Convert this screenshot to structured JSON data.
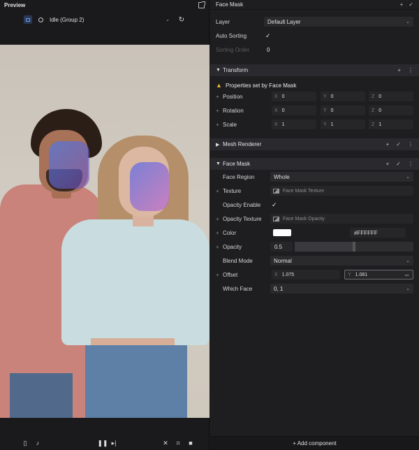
{
  "preview": {
    "title": "Preview",
    "state_select": "Idle (Group 2)"
  },
  "inspector": {
    "title": "Face Mask",
    "layer_label": "Layer",
    "layer_value": "Default Layer",
    "auto_sorting_label": "Auto Sorting",
    "sorting_order_label": "Sorting Order",
    "sorting_order_value": "0",
    "transform": {
      "title": "Transform",
      "warning": "Properties set by Face Mask",
      "position_label": "Position",
      "rotation_label": "Rotation",
      "scale_label": "Scale",
      "position": {
        "x": "0",
        "y": "0",
        "z": "0"
      },
      "rotation": {
        "x": "0",
        "y": "0",
        "z": "0"
      },
      "scale": {
        "x": "1",
        "y": "1",
        "z": "1"
      },
      "axis_x": "X",
      "axis_y": "Y",
      "axis_z": "Z"
    },
    "mesh_renderer": {
      "title": "Mesh Renderer"
    },
    "face_mask": {
      "title": "Face Mask",
      "face_region_label": "Face Region",
      "face_region_value": "Whole",
      "texture_label": "Texture",
      "texture_value": "Face Mask Texture",
      "opacity_enable_label": "Opacity Enable",
      "opacity_texture_label": "Opacity Texture",
      "opacity_texture_value": "Face Mask Opacity",
      "color_label": "Color",
      "color_hex": "#FFFFFF",
      "opacity_label": "Opacity",
      "opacity_value": "0.5",
      "opacity_fraction": 0.5,
      "blend_mode_label": "Blend Mode",
      "blend_mode_value": "Normal",
      "offset_label": "Offset",
      "offset_x": "1.075",
      "offset_y": "1.081",
      "which_face_label": "Which Face",
      "which_face_value": "0, 1"
    },
    "add_component": "+ Add component"
  },
  "colors": {
    "accent": "#6ea0ff",
    "warning": "#e6b534",
    "swatch": "#FFFFFF"
  }
}
